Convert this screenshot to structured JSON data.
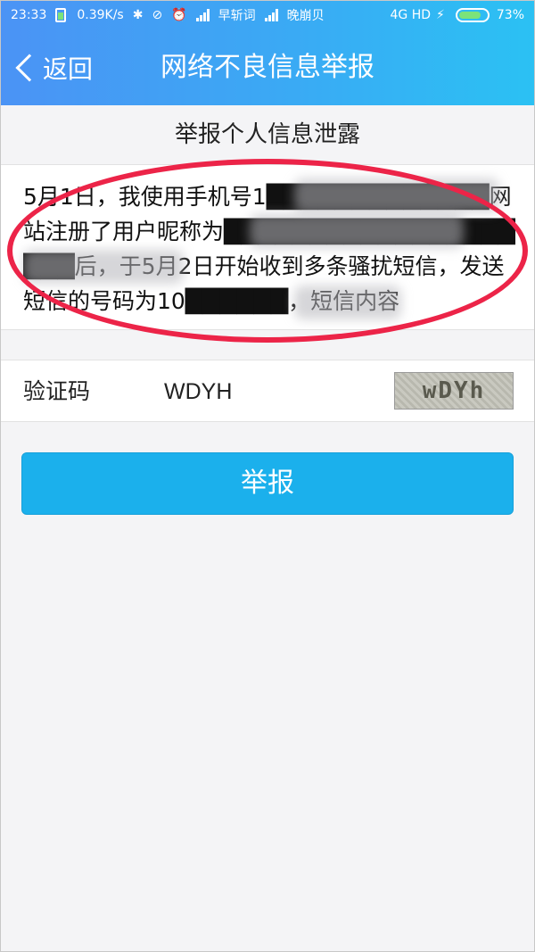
{
  "status_bar": {
    "time": "23:33",
    "net_speed": "0.39K/s",
    "carrier1": "早斩词",
    "carrier2": "晚崩贝",
    "network": "4G HD",
    "battery": "73%"
  },
  "nav": {
    "back_label": "返回",
    "title": "网络不良信息举报"
  },
  "form": {
    "section_title": "举报个人信息泄露",
    "description": "5月1日，我使用手机号1█████████████网站注册了用户昵称为████████████████████后，于5月2日开始收到多条骚扰短信，发送短信的号码为10██████，短信内容",
    "captcha_label": "验证码",
    "captcha_value": "WDYH",
    "captcha_image_text": "wDYh",
    "submit_label": "举报"
  },
  "colors": {
    "header_start": "#4b93f5",
    "header_end": "#2bc1f3",
    "button": "#1bb0ec",
    "highlight": "#ec2448"
  }
}
